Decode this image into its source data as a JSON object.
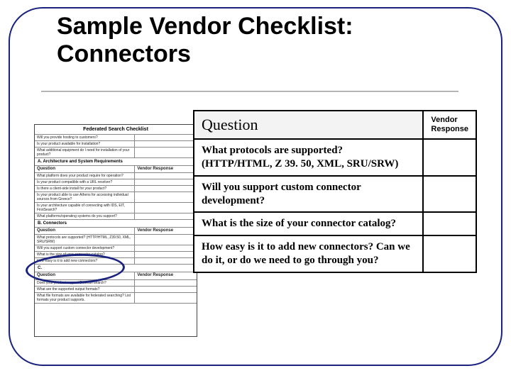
{
  "title": "Sample Vendor Checklist: Connectors",
  "thumb": {
    "heading": "Federated Search Checklist",
    "section1": "A. Architecture and System Requirements",
    "qh": "Question",
    "rh": "Vendor Response",
    "rows1": [
      "Will you provide hosting to customers?",
      "Is your product available for installation?",
      "What additional equipment do I need for installation of your product?",
      "What platform does your product require for operation?",
      "Is your product compatible with a URL resolver?",
      "Is there a client-side install for your product?",
      "Is your product able to use Athens for accessing individual sources from Greece?",
      "Is your architecture capable of connecting with IDS, EIT, FirstSearch?",
      "What platforms/operating systems do you support?"
    ],
    "sectionB": "B. Connectors",
    "rowsB": [
      "What protocols are supported? (HTTP/HTML, Z39.50, XML, SRU/SRW)",
      "Will you support custom connector development?",
      "What is the size of your connector catalog?",
      "How easy is it to add new connectors?"
    ],
    "sectionC": "C. ",
    "rowsC": [
      "Does your product support Boolean search?",
      "What are the supported output formats?",
      "What file formats are available for federated searching? List formats your product supports."
    ]
  },
  "table": {
    "question_header": "Question",
    "response_header": "Vendor Response",
    "rows": [
      {
        "q": "What protocols are supported? (HTTP/HTML, Z 39. 50, XML, SRU/SRW)"
      },
      {
        "q": "Will you support custom connector development?"
      },
      {
        "q": "What is the size of your connector catalog?"
      },
      {
        "q": "How easy is it to add new connectors? Can we do it, or do we need to go through you?"
      }
    ]
  }
}
